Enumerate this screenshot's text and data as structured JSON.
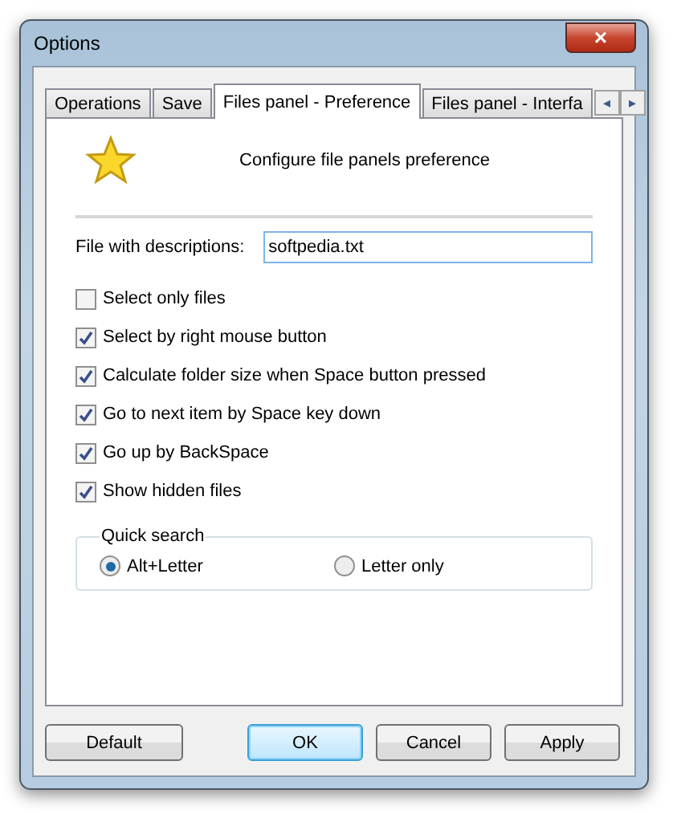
{
  "window": {
    "title": "Options",
    "close": "×"
  },
  "tabs": [
    {
      "label": "Operations",
      "selected": false
    },
    {
      "label": "Save",
      "selected": false
    },
    {
      "label": "Files panel - Preference",
      "selected": true
    },
    {
      "label": "Files panel - Interfa",
      "selected": false
    }
  ],
  "tab_scroll": [
    "◂",
    "▸"
  ],
  "header": {
    "text": "Configure file panels preference"
  },
  "descriptions_file": {
    "label": "File with descriptions:",
    "value": "softpedia.txt"
  },
  "options": [
    {
      "label": "Select only files",
      "checked": false
    },
    {
      "label": "Select by right mouse button",
      "checked": true
    },
    {
      "label": "Calculate folder size when Space button pressed",
      "checked": true
    },
    {
      "label": "Go to next item by Space key down",
      "checked": true
    },
    {
      "label": "Go up by BackSpace",
      "checked": true
    },
    {
      "label": "Show hidden files",
      "checked": true
    }
  ],
  "quick_search": {
    "title": "Quick search",
    "choices": [
      {
        "label": "Alt+Letter",
        "selected": true
      },
      {
        "label": "Letter only",
        "selected": false
      }
    ]
  },
  "buttons": [
    {
      "label": "Default",
      "default": false
    },
    {
      "label": "OK",
      "default": true
    },
    {
      "label": "Cancel",
      "default": false
    },
    {
      "label": "Apply",
      "default": false
    }
  ]
}
